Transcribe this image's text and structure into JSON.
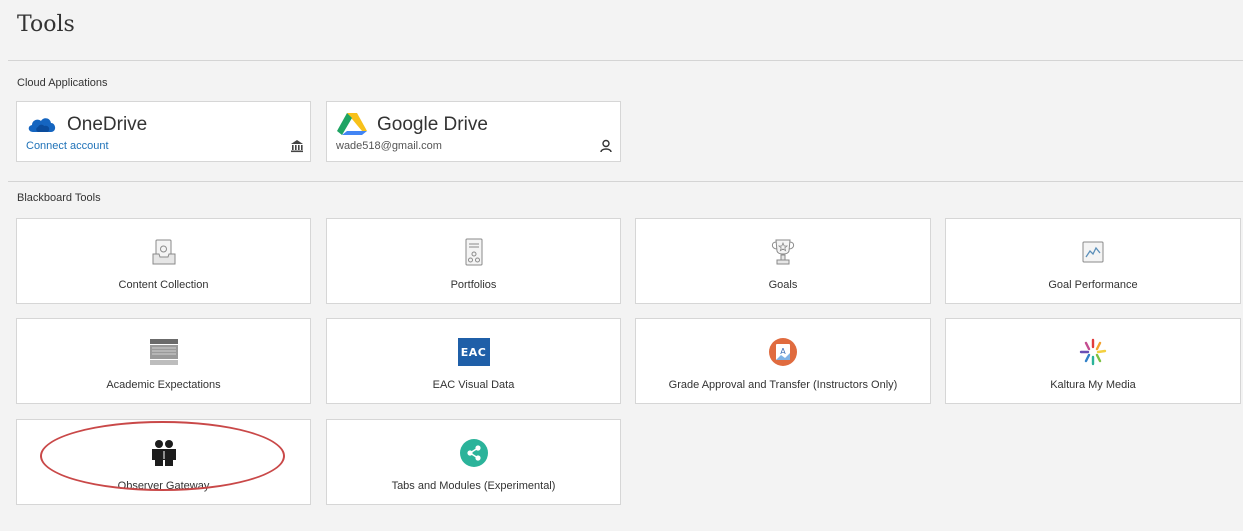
{
  "page": {
    "title": "Tools"
  },
  "cloud": {
    "section_label": "Cloud Applications",
    "onedrive": {
      "name": "OneDrive",
      "action": "Connect account",
      "badge_icon": "institution-icon",
      "color": "#1565c0"
    },
    "googledrive": {
      "name": "Google Drive",
      "account": "wade518@gmail.com",
      "badge_icon": "user-icon"
    }
  },
  "blackboard": {
    "section_label": "Blackboard Tools",
    "tools": [
      {
        "label": "Content Collection",
        "icon": "folder-doc-icon"
      },
      {
        "label": "Portfolios",
        "icon": "portfolio-icon"
      },
      {
        "label": "Goals",
        "icon": "trophy-icon"
      },
      {
        "label": "Goal Performance",
        "icon": "chart-image-icon"
      },
      {
        "label": "Academic Expectations",
        "icon": "document-image-icon"
      },
      {
        "label": "EAC Visual Data",
        "icon": "eac-logo-icon",
        "icon_text": "EAC",
        "icon_color": "#1f5fa8"
      },
      {
        "label": "Grade Approval and Transfer (Instructors Only)",
        "icon": "grade-approval-icon",
        "icon_color": "#e06b3f"
      },
      {
        "label": "Kaltura My Media",
        "icon": "kaltura-icon"
      },
      {
        "label": "Observer Gateway",
        "icon": "people-icon"
      },
      {
        "label": "Tabs and Modules (Experimental)",
        "icon": "share-network-icon",
        "icon_color": "#2bb39a"
      }
    ]
  },
  "colors": {
    "highlight": "#c94848",
    "link": "#1f72b8"
  }
}
